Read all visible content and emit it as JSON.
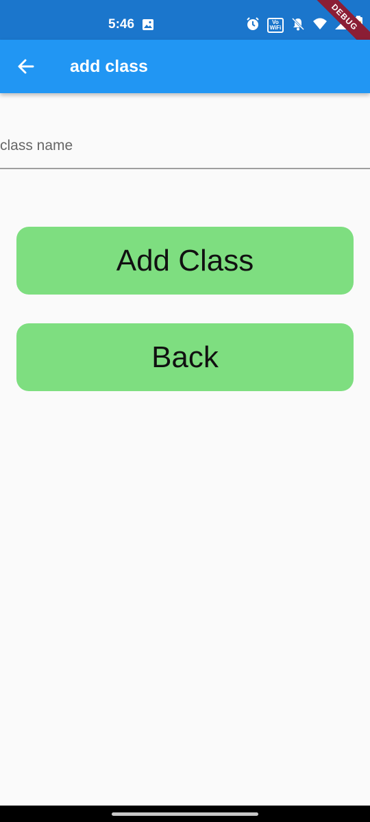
{
  "status_bar": {
    "time": "5:46",
    "volte_top": "Vo",
    "volte_bottom": "WiFi",
    "icons": [
      "gallery-icon",
      "alarm-icon",
      "volte-wifi-icon",
      "notifications-off-icon",
      "wifi-icon",
      "signal-icon",
      "battery-icon"
    ],
    "background": "#1b76cc"
  },
  "debug_banner": {
    "label": "DEBUG",
    "color": "#8b1e35"
  },
  "app_bar": {
    "title": "add class",
    "back_icon": "arrow-back-icon",
    "background": "#2196f3"
  },
  "form": {
    "class_name": {
      "placeholder": "class name",
      "value": ""
    }
  },
  "buttons": {
    "add_class": "Add Class",
    "back": "Back",
    "color": "#7ede80"
  }
}
